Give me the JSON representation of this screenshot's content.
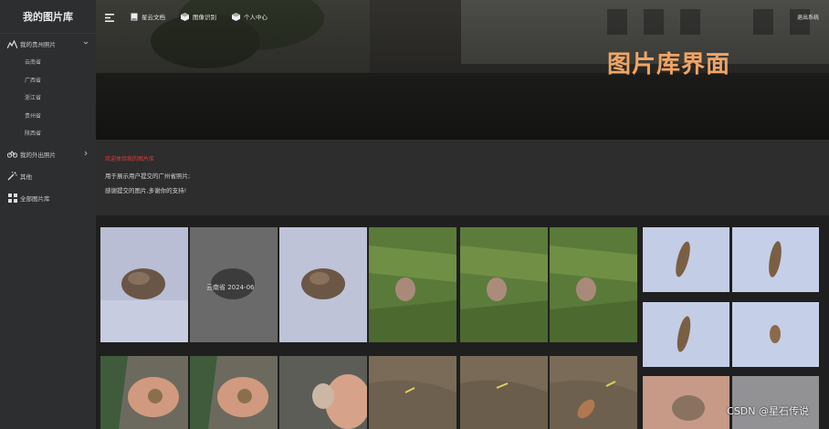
{
  "app": {
    "title": "我的图片库"
  },
  "sidebar": {
    "menu1": {
      "label": "我的贵州照片"
    },
    "sub_items": [
      {
        "label": "云南省"
      },
      {
        "label": "广西省"
      },
      {
        "label": "浙江省"
      },
      {
        "label": "贵州省"
      },
      {
        "label": "陕西省"
      }
    ],
    "menu2": {
      "label": "我的外出照片"
    },
    "menu3": {
      "label": "其他"
    },
    "menu4": {
      "label": "全部图片库"
    }
  },
  "topbar": {
    "btn1": "星云文档",
    "btn2": "图像识别",
    "btn3": "个人中心",
    "right": "退出系统"
  },
  "hero": {
    "title": "图片库界面"
  },
  "info": {
    "warn": "欢迎体验我的图片库",
    "line1": "用于展示用户提交的广州省照片;",
    "line2": "感谢提交的图片,多谢你的支持!"
  },
  "gallery": {
    "overlay_text": "云南省  2024-06"
  },
  "watermark": "CSDN @星石传说",
  "colors": {
    "accent": "#f0a566",
    "warn": "#e23b3b",
    "sidebar": "#2d2e30"
  }
}
